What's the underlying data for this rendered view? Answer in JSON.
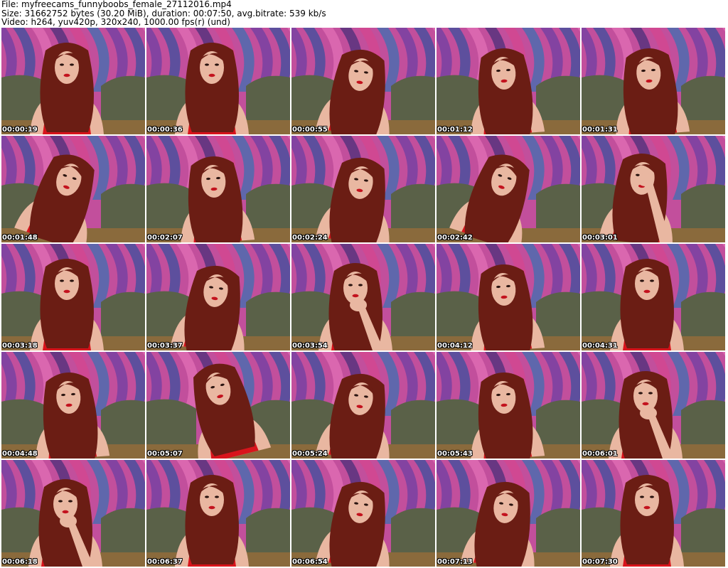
{
  "header": {
    "file_line": "File: myfreecams_funnyboobs_female_27112016.mp4",
    "size_line": "Size: 31662752 bytes (30.20 MiB), duration: 00:07:50, avg.bitrate: 539 kb/s",
    "video_line": "Video: h264, yuv420p, 320x240, 1000.00 fps(r) (und)"
  },
  "grid": {
    "columns": 5,
    "rows": 5
  },
  "thumbnails": [
    {
      "timestamp": "00:00:19",
      "pose": "facing-camera"
    },
    {
      "timestamp": "00:00:36",
      "pose": "facing-camera"
    },
    {
      "timestamp": "00:00:55",
      "pose": "leaning-forward"
    },
    {
      "timestamp": "00:01:12",
      "pose": "looking-down"
    },
    {
      "timestamp": "00:01:31",
      "pose": "looking-down"
    },
    {
      "timestamp": "00:01:48",
      "pose": "head-tilted"
    },
    {
      "timestamp": "00:02:07",
      "pose": "looking-down"
    },
    {
      "timestamp": "00:02:24",
      "pose": "leaning-forward"
    },
    {
      "timestamp": "00:02:42",
      "pose": "head-tilted"
    },
    {
      "timestamp": "00:03:01",
      "pose": "hand-on-face"
    },
    {
      "timestamp": "00:03:18",
      "pose": "facing-camera"
    },
    {
      "timestamp": "00:03:37",
      "pose": "leaning-forward"
    },
    {
      "timestamp": "00:03:54",
      "pose": "hand-on-chin"
    },
    {
      "timestamp": "00:04:12",
      "pose": "looking-down"
    },
    {
      "timestamp": "00:04:31",
      "pose": "facing-camera"
    },
    {
      "timestamp": "00:04:48",
      "pose": "looking-down"
    },
    {
      "timestamp": "00:05:07",
      "pose": "head-back"
    },
    {
      "timestamp": "00:05:24",
      "pose": "leaning-forward"
    },
    {
      "timestamp": "00:05:43",
      "pose": "looking-down"
    },
    {
      "timestamp": "00:06:01",
      "pose": "hand-on-chin"
    },
    {
      "timestamp": "00:06:18",
      "pose": "hand-on-chin"
    },
    {
      "timestamp": "00:06:37",
      "pose": "facing-camera"
    },
    {
      "timestamp": "00:06:54",
      "pose": "leaning-forward"
    },
    {
      "timestamp": "00:07:13",
      "pose": "leaning-forward"
    },
    {
      "timestamp": "00:07:30",
      "pose": "facing-camera"
    }
  ],
  "colors": {
    "backdrop_pink": "#c24f9c",
    "backdrop_purple": "#6e3fa3",
    "backdrop_blue": "#3b4f9e",
    "couch_green": "#5a6148",
    "hair": "#6b1d14",
    "skin": "#e9b7a1",
    "dress_red": "#d8141c",
    "text_overlay": "#ffffff"
  }
}
